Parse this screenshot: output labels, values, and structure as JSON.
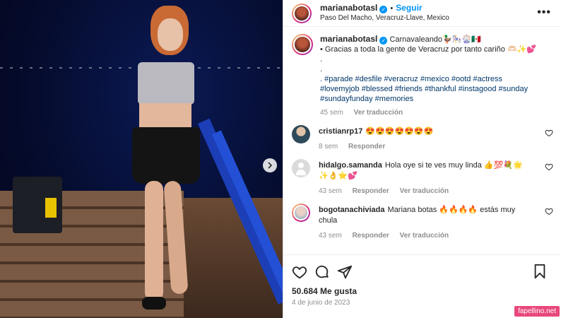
{
  "header": {
    "username": "marianabotasl",
    "follow_label": "Seguir",
    "location": "Paso Del Macho, Veracruz-Llave, Mexico",
    "more_label": "•••"
  },
  "caption": {
    "username": "marianabotasl",
    "title": "Carnavaleando🦆🎠🎡🇲🇽",
    "line1": "• Gracias a toda la gente de Veracruz por tanto cariño 🫶🏻✨💕",
    "dot1": ".",
    "dot2": ".",
    "tags_line1": ". #parade #desfile #veracruz #mexico #ootd #actress",
    "tags_line2": "#lovemyjob #blessed #friends #thankful #instagood #sunday",
    "tags_line3": "#sundayfunday #memories",
    "time": "45 sem",
    "translate": "Ver traducción"
  },
  "comments": [
    {
      "username": "cristianrp17",
      "text": "😍😍😍😍😍😍😍",
      "time": "8 sem",
      "reply": "Responder",
      "translate": ""
    },
    {
      "username": "hidalgo.samanda",
      "text": "Hola oye si te ves muy linda 👍💯💐🌟✨👌⭐💕",
      "time": "43 sem",
      "reply": "Responder",
      "translate": "Ver traducción"
    },
    {
      "username": "bogotanachiviada",
      "text": "Mariana botas 🔥🔥🔥🔥 estás muy chula",
      "time": "43 sem",
      "reply": "Responder",
      "translate": "Ver traducción"
    }
  ],
  "footer": {
    "likes": "50.684 Me gusta",
    "date": "4 de junio de 2023"
  },
  "watermark": "fapellino.net",
  "icons": [
    "verified-badge-icon",
    "heart-icon",
    "comment-icon",
    "share-icon",
    "bookmark-icon",
    "next-arrow-icon",
    "more-options-icon"
  ],
  "colors": {
    "accent": "#0095f6",
    "hashtag": "#00376b",
    "muted": "#8e8e8e",
    "watermark": "#e8487b"
  }
}
